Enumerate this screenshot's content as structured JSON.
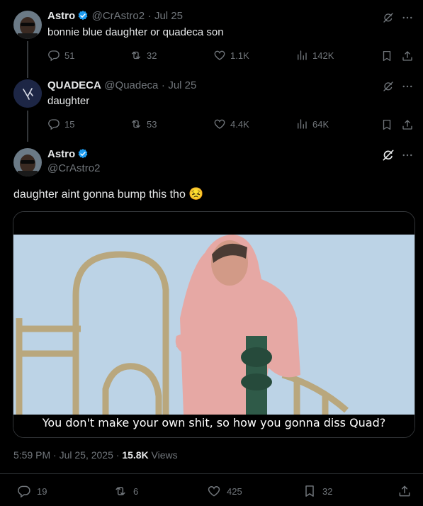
{
  "tweet1": {
    "name": "Astro",
    "handle": "@CrAstro2",
    "sep": "·",
    "date": "Jul 25",
    "text": "bonnie blue daughter or quadeca son",
    "replies": "51",
    "retweets": "32",
    "likes": "1.1K",
    "views": "142K"
  },
  "tweet2": {
    "name": "QUADECA",
    "handle": "@Quadeca",
    "sep": "·",
    "date": "Jul 25",
    "text": "daughter",
    "replies": "15",
    "retweets": "53",
    "likes": "4.4K",
    "views": "64K"
  },
  "main": {
    "name": "Astro",
    "handle": "@CrAstro2",
    "text": "daughter aint gonna bump this tho",
    "emoji": "😣",
    "media_caption": "You don't make your own shit, so how you gonna diss Quad?",
    "time": "5:59 PM · Jul 25, 2025 · ",
    "views_count": "15.8K",
    "views_label": " Views",
    "replies": "19",
    "retweets": "6",
    "likes": "425",
    "bookmarks": "32"
  },
  "colors": {
    "background": "#000000",
    "verified": "#1d9bf0",
    "muted": "#71767b",
    "text": "#e7e9ea",
    "border": "#2f3336"
  },
  "icons": [
    "verified-badge-icon",
    "grok-icon",
    "more-icon",
    "reply-icon",
    "retweet-icon",
    "like-icon",
    "views-icon",
    "bookmark-icon",
    "share-icon"
  ]
}
